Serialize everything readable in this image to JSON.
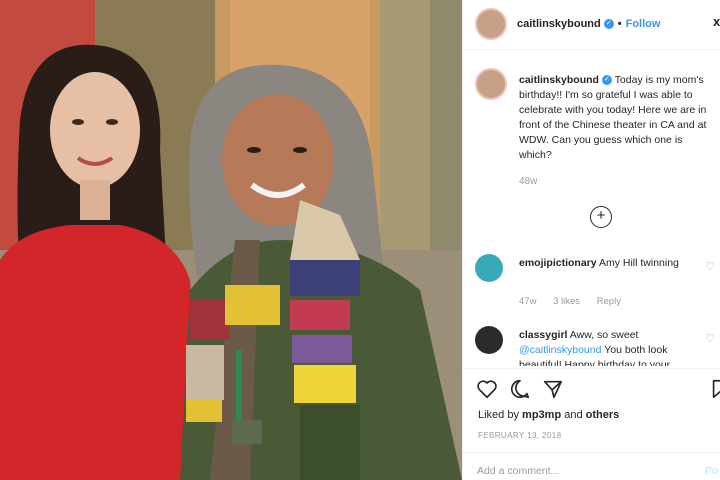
{
  "header": {
    "username": "caitlinskybound",
    "dot": "•",
    "follow_label": "Follow",
    "more_glyph": "x"
  },
  "caption": {
    "username": "caitlinskybound",
    "text": "Today is my mom's birthday!! I'm so grateful I was able to celebrate with you today! Here we are in front of the Chinese theater in CA and at WDW. Can you guess which one is which?",
    "age": "48w"
  },
  "comments": [
    {
      "username": "emojipictionary",
      "text": "Amy Hill twinning",
      "age": "47w",
      "likes": "3 likes",
      "reply": "Reply"
    },
    {
      "username": "classygirl",
      "text_before": "Aww, so sweet",
      "mention": "@caitlinskybound",
      "text_after": "You both look beautiful! Happy birthday to your"
    }
  ],
  "actions": {
    "liked_by_prefix": "Liked by",
    "liked_by_user": "mp3mp",
    "liked_by_and": "and",
    "liked_by_others": "others",
    "date": "FEBRUARY 13, 2018"
  },
  "add_comment": {
    "placeholder": "Add a comment...",
    "post_label": "Po"
  },
  "icons": {
    "verified": "verified-badge-icon",
    "more_comments": "plus-circle-icon",
    "like": "heart-icon",
    "comment": "speech-bubble-icon",
    "share": "paper-plane-icon",
    "save": "bookmark-icon"
  },
  "colors": {
    "accent": "#3897f0",
    "muted": "#999999",
    "border": "#efefef"
  }
}
